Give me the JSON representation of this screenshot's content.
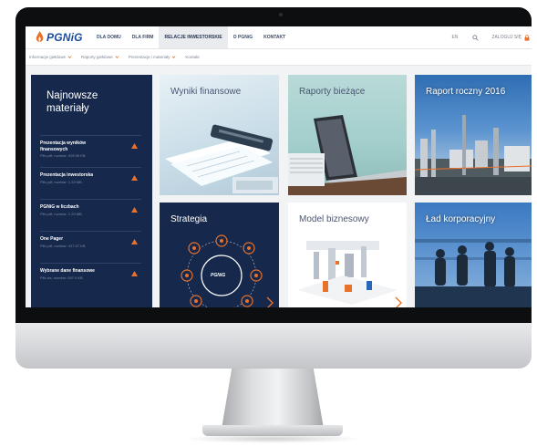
{
  "nav": {
    "logo_text": "PGNiG",
    "items": [
      "DLA DOMU",
      "DLA FIRM",
      "RELACJE INWESTORSKIE",
      "O PGNiG",
      "KONTAKT"
    ],
    "active_index": 2,
    "lang": "EN",
    "login": "ZALOGUJ SIĘ"
  },
  "subnav": {
    "items": [
      "Informacje giełdowe",
      "Raporty giełdowe",
      "Prezentacje i materiały",
      "Kontakt"
    ]
  },
  "sidebar": {
    "title": "Najnowsze materiały",
    "items": [
      {
        "title": "Prezentacja wyników finansowych",
        "meta": "Plik pdf, rozmiar: 928.96 KB"
      },
      {
        "title": "Prezentacja inwestorska",
        "meta": "Plik pdf, rozmiar: 1.33 MB"
      },
      {
        "title": "PGNiG w liczbach",
        "meta": "Plik pdf, rozmiar: 1.29 MB"
      },
      {
        "title": "One Pager",
        "meta": "Plik pdf, rozmiar: 437.07 KB"
      },
      {
        "title": "Wybrane dane finansowe",
        "meta": "Plik xls, rozmiar: 057.0 KB"
      }
    ]
  },
  "tiles": [
    {
      "title": "Wyniki finansowe"
    },
    {
      "title": "Raporty bieżące"
    },
    {
      "title": "Raport roczny 2016"
    },
    {
      "title": "Strategia",
      "circle_label": "PGNiG"
    },
    {
      "title": "Model biznesowy"
    },
    {
      "title": "Ład korporacyjny"
    }
  ],
  "colors": {
    "brand_blue": "#1a4b9b",
    "accent_orange": "#e8712b",
    "sidebar_bg": "#16284b"
  }
}
